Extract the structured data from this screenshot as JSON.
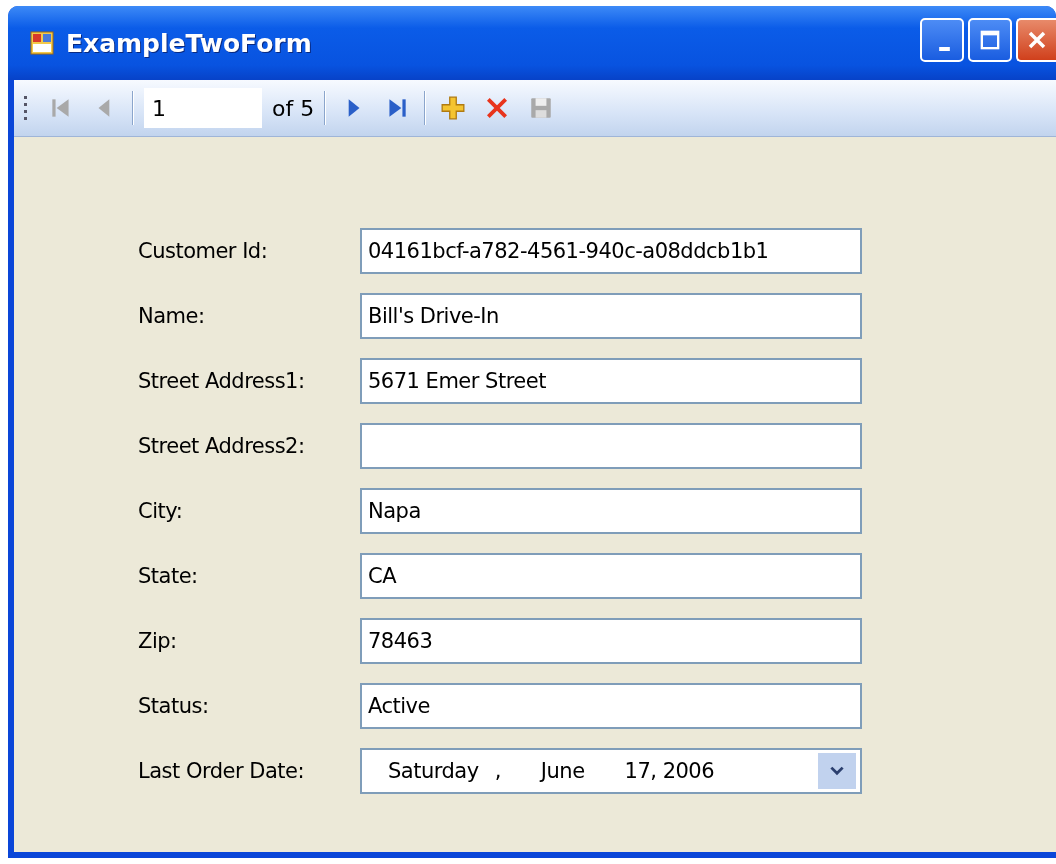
{
  "window": {
    "title": "ExampleTwoForm",
    "buttons": [
      {
        "kind": "minimize"
      },
      {
        "kind": "maximize"
      },
      {
        "kind": "close"
      }
    ]
  },
  "toolbar": {
    "items": [
      {
        "kind": "first",
        "disabled": true
      },
      {
        "kind": "prev",
        "disabled": true
      },
      {
        "kind": "separator"
      },
      {
        "kind": "position",
        "value": "1"
      },
      {
        "kind": "count",
        "text": "of 5"
      },
      {
        "kind": "separator"
      },
      {
        "kind": "next",
        "disabled": false
      },
      {
        "kind": "last",
        "disabled": false
      },
      {
        "kind": "separator"
      },
      {
        "kind": "add",
        "disabled": false
      },
      {
        "kind": "delete",
        "disabled": false
      },
      {
        "kind": "save",
        "disabled": true
      }
    ]
  },
  "fields": [
    {
      "label": "Customer Id:",
      "kind": "text",
      "value": "04161bcf-a782-4561-940c-a08ddcb1b1"
    },
    {
      "label": "Name:",
      "kind": "text",
      "value": "Bill's Drive-In"
    },
    {
      "label": "Street Address1:",
      "kind": "text",
      "value": "5671 Emer Street"
    },
    {
      "label": "Street Address2:",
      "kind": "text"
    },
    {
      "label": "City:",
      "kind": "text",
      "value": "Napa"
    },
    {
      "label": "State:",
      "kind": "text",
      "value": "CA"
    },
    {
      "label": "Zip:",
      "kind": "text",
      "value": "78463"
    },
    {
      "label": "Status:",
      "kind": "text",
      "value": "Active"
    },
    {
      "label": "Last Order Date:",
      "kind": "date",
      "parts": [
        "Saturday",
        ",",
        "June",
        "17, 2006"
      ]
    }
  ]
}
